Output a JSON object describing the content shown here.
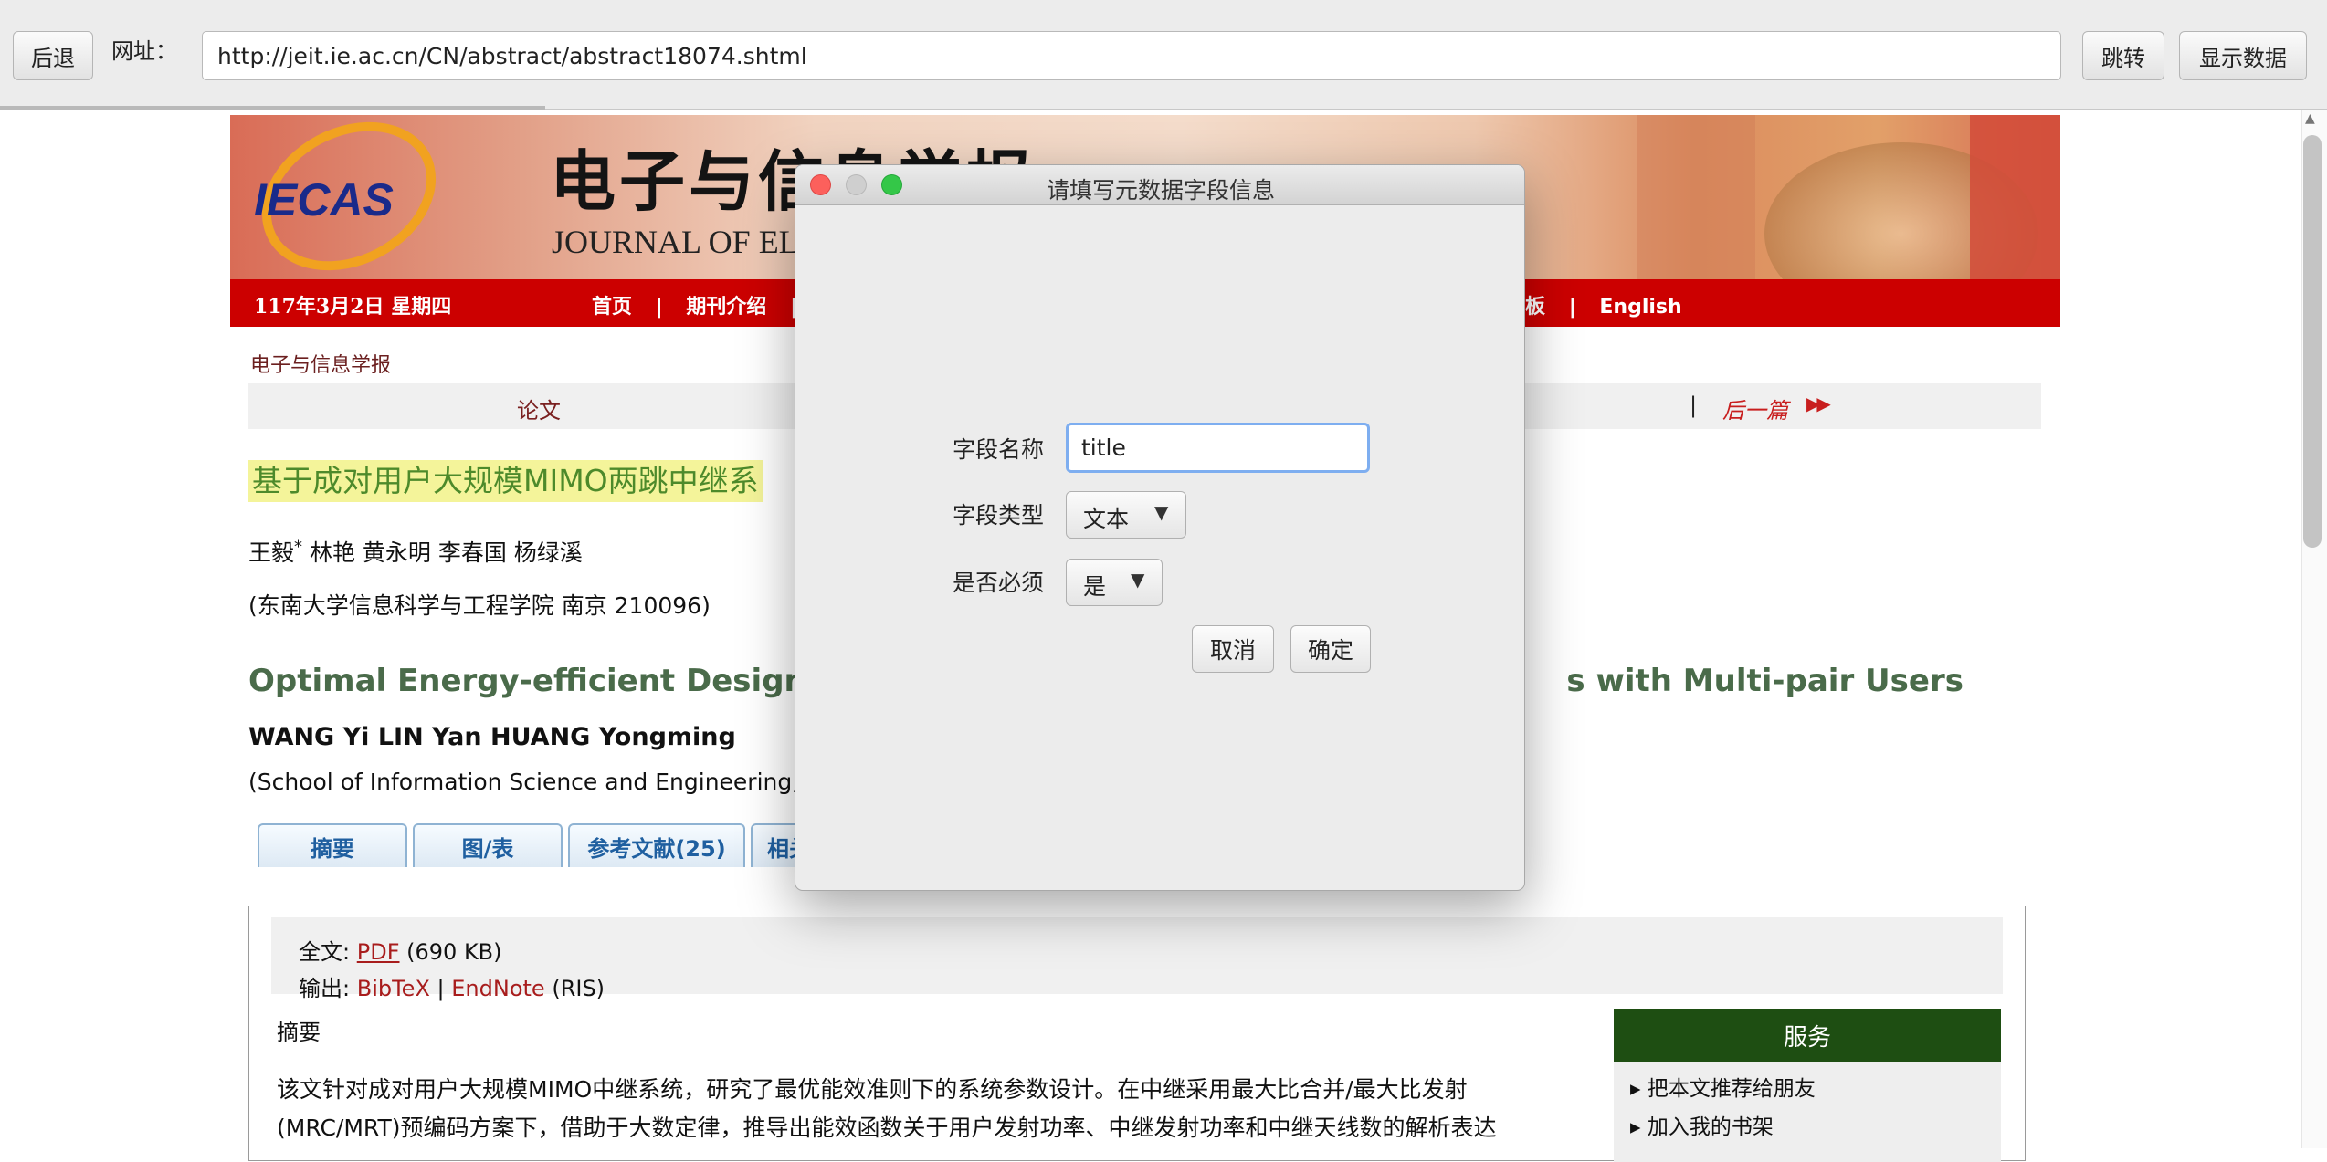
{
  "toolbar": {
    "back_label": "后退",
    "url_label": "网址：",
    "url_value": "http://jeit.ie.ac.cn/CN/abstract/abstract18074.shtml",
    "go_label": "跳转",
    "show_data_label": "显示数据"
  },
  "page": {
    "banner": {
      "logo_text": "IECAS",
      "title_cn": "电子与信息学报",
      "title_en": "JOURNAL OF ELE"
    },
    "nav": {
      "date": "117年3月2日 星期四",
      "items_left": [
        "首页",
        "期刊介绍"
      ],
      "items_right": [
        "板",
        "English"
      ],
      "separator": "|"
    },
    "breadcrumb": "电子与信息学报",
    "section_label": "论文",
    "next_label": "后一篇",
    "next_arrows": "▶▶",
    "title_cn": "基于成对用户大规模MIMO两跳中继系",
    "authors_cn": "王毅",
    "authors_cn_mark": "*",
    "authors_cn_rest": " 林艳  黄永明  李春国  杨绿溪",
    "affiliation_cn": "(东南大学信息科学与工程学院 南京 210096)",
    "title_en_left": "Optimal Energy-efficient Design f",
    "title_en_right": "s with Multi-pair Users",
    "authors_en": "WANG Yi    LIN Yan    HUANG Yongming",
    "affiliation_en": "(School of Information Science and Engineering, S",
    "tabs": [
      "摘要",
      "图/表",
      "参考文献(25)",
      "相关"
    ],
    "fulltext": {
      "label": "全文:",
      "pdf_link": "PDF",
      "size": "(690 KB)"
    },
    "export": {
      "label": "输出:",
      "bibtex": "BibTeX",
      "sep": "|",
      "endnote": "EndNote",
      "ris": "(RIS)"
    },
    "abstract_label": "摘要",
    "abstract_text": "该文针对成对用户大规模MIMO中继系统，研究了最优能效准则下的系统参数设计。在中继采用最大比合并/最大比发射(MRC/MRT)预编码方案下，借助于大数定律，推导出能效函数关于用户发射功率、中继发射功率和中继天线数的解析表达",
    "service": {
      "title": "服务",
      "items": [
        "把本文推荐给朋友",
        "加入我的书架"
      ]
    }
  },
  "dialog": {
    "title": "请填写元数据字段信息",
    "field_name_label": "字段名称",
    "field_name_value": "title",
    "field_type_label": "字段类型",
    "field_type_value": "文本",
    "required_label": "是否必须",
    "required_value": "是",
    "cancel_label": "取消",
    "ok_label": "确定"
  }
}
